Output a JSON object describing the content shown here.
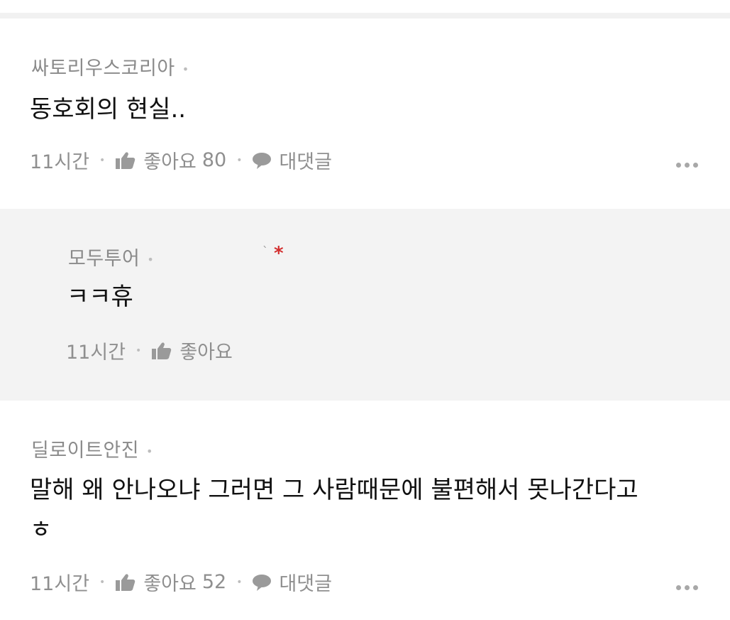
{
  "comments": [
    {
      "author": "싸토리우스코리아",
      "text": "동호회의 현실..",
      "time": "11시간",
      "like_label": "좋아요",
      "like_count": "80",
      "reply_label": "대댓글"
    },
    {
      "author": "모두투어",
      "author_mark": "*",
      "text": "ㅋㅋ휴",
      "time": "11시간",
      "like_label": "좋아요"
    },
    {
      "author": "딜로이트안진",
      "text_line1": "말해 왜 안나오냐 그러면 그 사람때문에 불편해서 못나간다고",
      "text_line2": "ㅎ",
      "time": "11시간",
      "like_label": "좋아요",
      "like_count": "52",
      "reply_label": "대댓글"
    }
  ],
  "icons": {
    "like": "thumbs-up-icon",
    "reply": "speech-bubble-icon",
    "more": "more-dots-icon"
  },
  "colors": {
    "reply_background": "#f3f3f3",
    "meta_text": "#8f8f8f",
    "mark": "#d32f2f"
  }
}
